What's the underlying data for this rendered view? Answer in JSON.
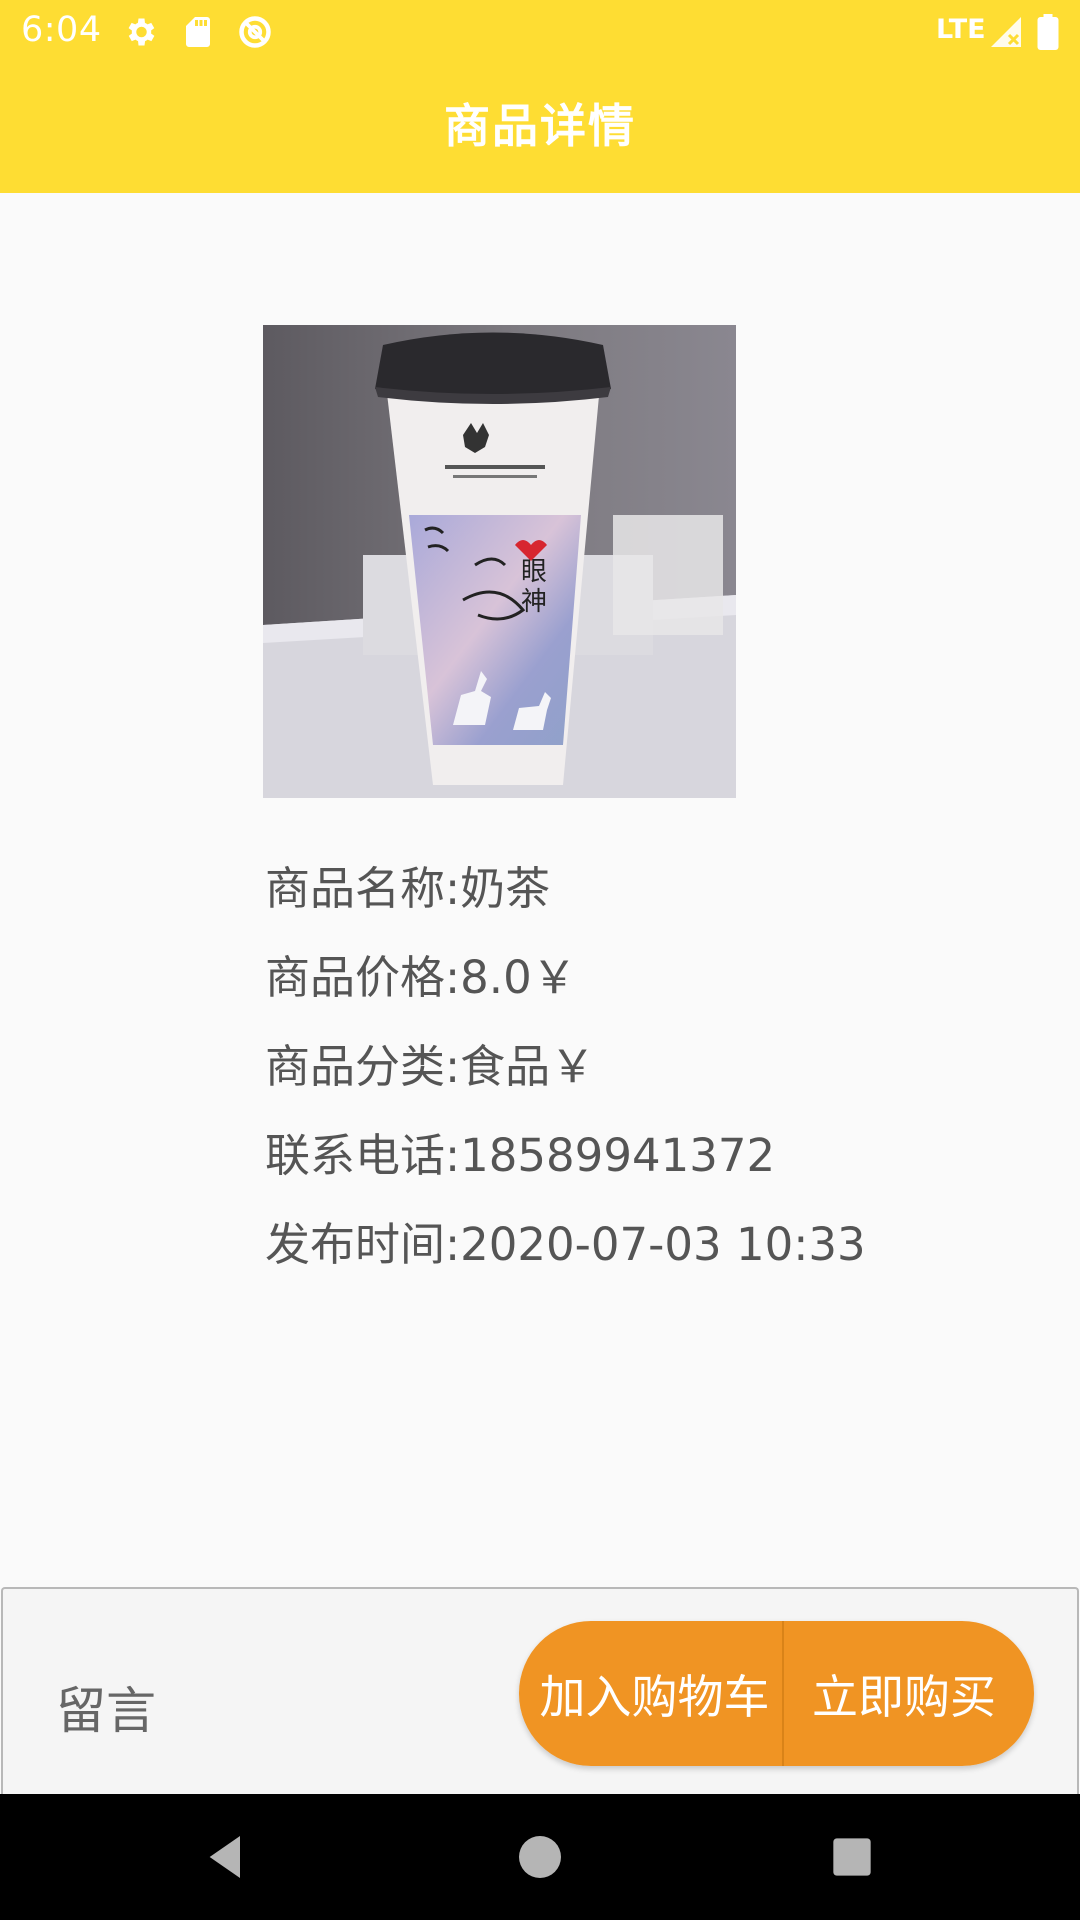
{
  "status_bar": {
    "time": "6:04",
    "network": "LTE",
    "icons": [
      "settings-icon",
      "sd-card-icon",
      "sync-icon",
      "lte-signal-icon",
      "battery-icon"
    ]
  },
  "toolbar": {
    "title": "商品详情"
  },
  "product": {
    "image_alt": "奶茶",
    "name_line": "商品名称:奶茶",
    "price_line": "商品价格:8.0￥",
    "category_line": "商品分类:食品￥",
    "phone_line": "联系电话:18589941372",
    "time_line": "发布时间:2020-07-03 10:33"
  },
  "actions": {
    "message_label": "留言",
    "add_to_cart_label": "加入购物车",
    "buy_now_label": "立即购买"
  },
  "nav_bar": {
    "icons": [
      "back-icon",
      "home-icon",
      "recents-icon"
    ]
  },
  "colors": {
    "header": "#fedd33",
    "accent": "#f09423",
    "text": "#555555"
  }
}
